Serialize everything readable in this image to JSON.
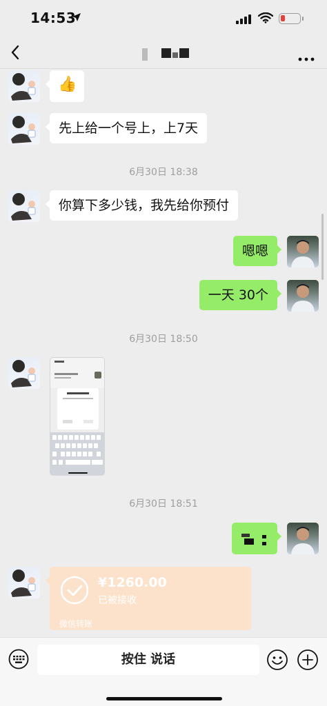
{
  "status_bar": {
    "time": "14:53"
  },
  "nav": {
    "back_icon": "chevron-left-icon",
    "more_icon": "more-dots-icon"
  },
  "messages": [
    {
      "side": "left",
      "type": "emoji",
      "emoji": "👍"
    },
    {
      "side": "left",
      "type": "text",
      "text": "先上给一个号上，上7天"
    },
    {
      "type": "time",
      "text": "6月30日 18:38"
    },
    {
      "side": "left",
      "type": "text",
      "text": "你算下多少钱，我先给你预付"
    },
    {
      "side": "right",
      "type": "text",
      "text": "嗯嗯"
    },
    {
      "side": "right",
      "type": "text",
      "text": "一天 30个"
    },
    {
      "type": "time",
      "text": "6月30日 18:50"
    },
    {
      "side": "left",
      "type": "image"
    },
    {
      "type": "time",
      "text": "6月30日 18:51"
    },
    {
      "side": "right",
      "type": "text",
      "text": ""
    },
    {
      "side": "left",
      "type": "transfer",
      "amount": "¥1260.00",
      "status": "已被接收",
      "footer": "微信转账"
    }
  ],
  "input_bar": {
    "talk_label": "按住 说话"
  },
  "colors": {
    "right_bubble": "#95ec69",
    "transfer": "#fde2cb",
    "background": "#ededed"
  }
}
